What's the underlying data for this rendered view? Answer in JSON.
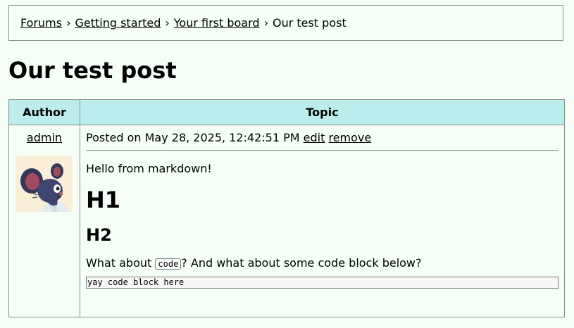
{
  "breadcrumb": {
    "items": [
      "Forums",
      "Getting started",
      "Your first board"
    ],
    "current": "Our test post",
    "separator": "›"
  },
  "page": {
    "title": "Our test post"
  },
  "table": {
    "headers": {
      "author": "Author",
      "topic": "Topic"
    }
  },
  "post": {
    "author": "admin",
    "posted_prefix": "Posted on",
    "timestamp": "May 28, 2025, 12:42:51 PM",
    "edit_label": "edit",
    "remove_label": "remove",
    "body": {
      "paragraph1": "Hello from markdown!",
      "heading1": "H1",
      "heading2": "H2",
      "paragraph2_before": "What about",
      "inline_code": "code",
      "paragraph2_after": "? And what about some code block below?",
      "code_block": "yay code block here"
    }
  },
  "colors": {
    "background": "#f5fff8",
    "header_bg": "#bcecec",
    "border": "#8a8a8a"
  }
}
